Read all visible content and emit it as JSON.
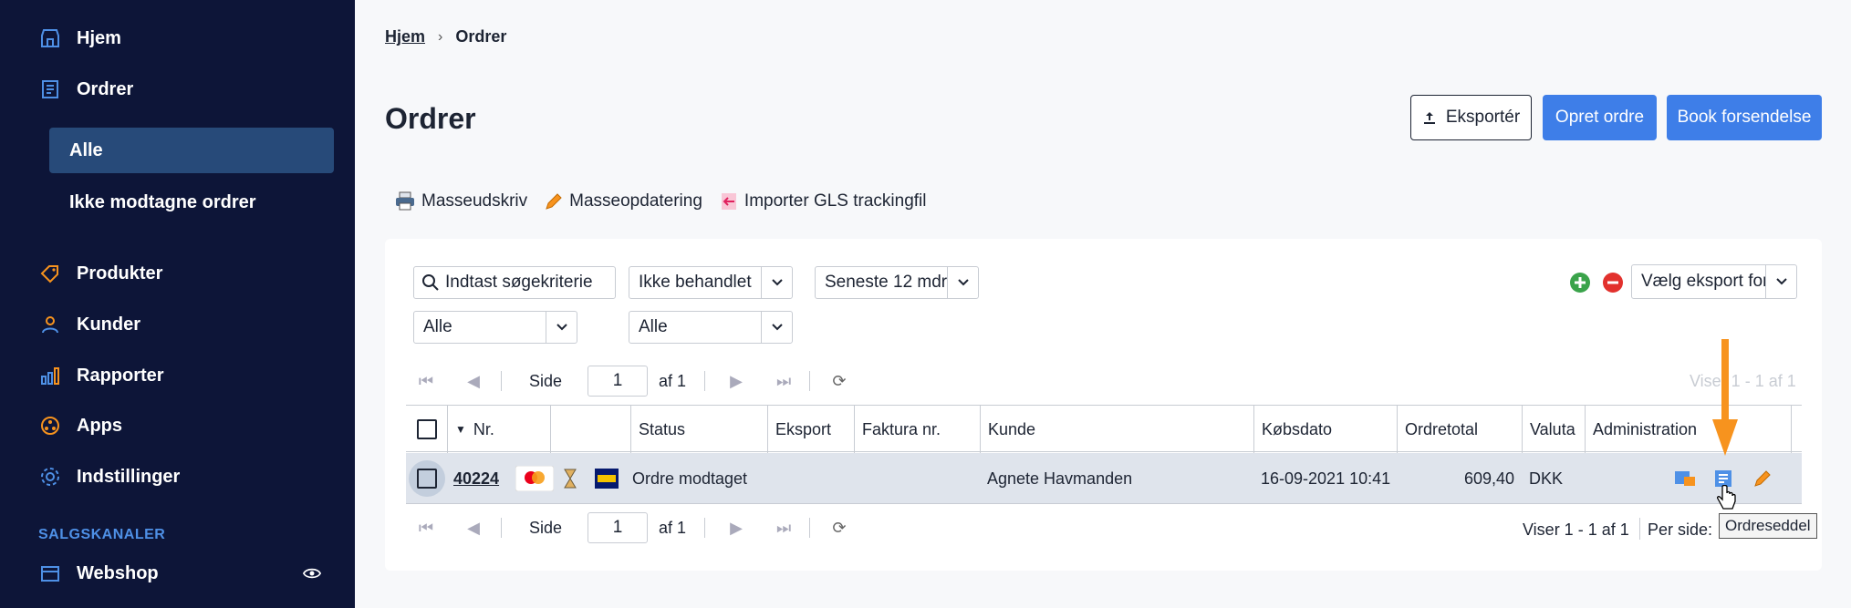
{
  "sidebar": {
    "items": [
      {
        "label": "Hjem",
        "icon": "home-icon"
      },
      {
        "label": "Ordrer",
        "icon": "orders-icon"
      },
      {
        "label": "Produkter",
        "icon": "tag-icon"
      },
      {
        "label": "Kunder",
        "icon": "user-icon"
      },
      {
        "label": "Rapporter",
        "icon": "bar-chart-icon"
      },
      {
        "label": "Apps",
        "icon": "apps-icon"
      },
      {
        "label": "Indstillinger",
        "icon": "gear-icon"
      }
    ],
    "subitems": [
      {
        "label": "Alle",
        "active": true
      },
      {
        "label": "Ikke modtagne ordrer",
        "active": false
      }
    ],
    "section_label": "SALGSKANALER",
    "channel": {
      "label": "Webshop",
      "icon": "store-icon"
    }
  },
  "breadcrumb": {
    "home": "Hjem",
    "current": "Ordrer"
  },
  "page": {
    "title": "Ordrer"
  },
  "actions": {
    "export": "Eksportér",
    "create": "Opret ordre",
    "book": "Book forsendelse"
  },
  "toolbar": {
    "print": "Masseudskriv",
    "update": "Masseopdatering",
    "import": "Importer GLS trackingfil"
  },
  "filters": {
    "search_placeholder": "Indtast søgekriterie",
    "status": "Ikke behandlet",
    "period": "Seneste 12 mdr",
    "filter_a": "Alle",
    "filter_b": "Alle",
    "export_format": "Vælg eksport format"
  },
  "pager_top": {
    "side": "Side",
    "page": "1",
    "of": "af 1",
    "info": "Viser 1 - 1 af 1"
  },
  "pager_bottom": {
    "side": "Side",
    "page": "1",
    "of": "af 1",
    "info": "Viser 1 - 1 af 1",
    "per_side": "Per side:"
  },
  "table": {
    "headers": {
      "nr": "Nr.",
      "status": "Status",
      "eksport": "Eksport",
      "faktura": "Faktura nr.",
      "kunde": "Kunde",
      "kobsdato": "Købsdato",
      "ordretotal": "Ordretotal",
      "valuta": "Valuta",
      "admin": "Administration"
    },
    "rows": [
      {
        "nr": "40224",
        "payment": "Mastercard",
        "carrier": "GLS",
        "status": "Ordre modtaget",
        "eksport": "",
        "faktura": "",
        "kunde": "Agnete Havmanden",
        "kobsdato": "16-09-2021 10:41",
        "ordretotal": "609,40",
        "valuta": "DKK"
      }
    ]
  },
  "tooltip": "Ordreseddel",
  "colors": {
    "sidebar": "#0d1538",
    "active": "#274a79",
    "accent": "#3e7ee8",
    "highlight": "#f7931e",
    "row": "#dfe4ec"
  }
}
